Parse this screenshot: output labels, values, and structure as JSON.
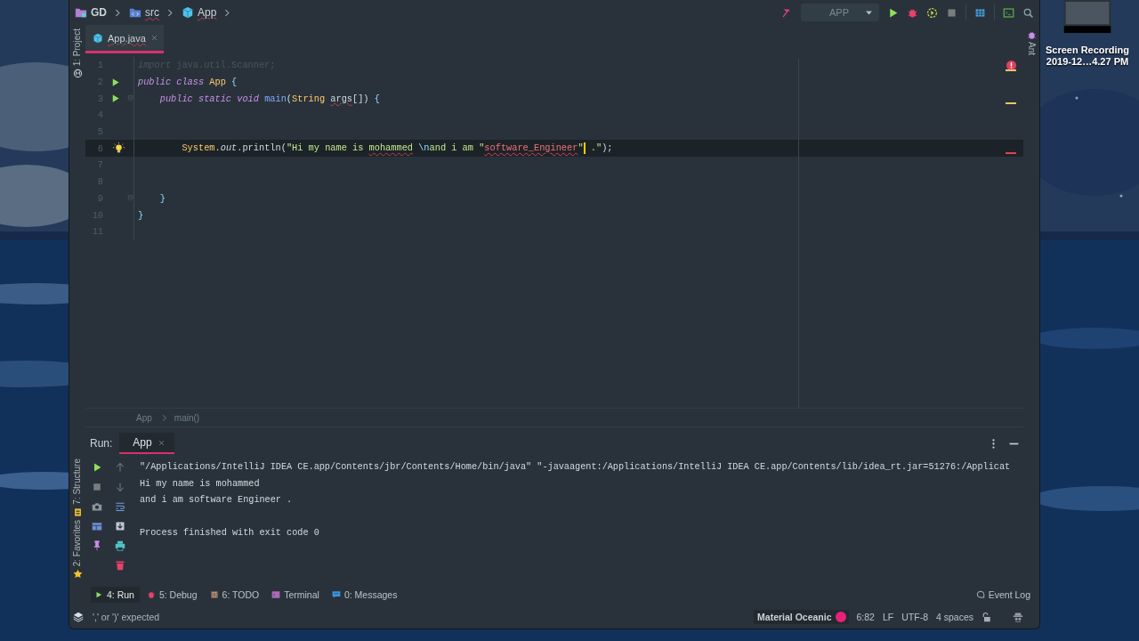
{
  "desktop_icon": {
    "label_lines": [
      "Screen Recording",
      "2019-12…4.27 PM"
    ]
  },
  "breadcrumbs": [
    {
      "label": "GD",
      "kind": "project"
    },
    {
      "label": "src",
      "kind": "source"
    },
    {
      "label": "App",
      "kind": "class"
    }
  ],
  "toolbar": {
    "run_configuration": "APP"
  },
  "left_tool_windows": {
    "top": [
      {
        "label": "1: Project",
        "kind": "project"
      }
    ],
    "bottom": [
      {
        "label": "7: Structure",
        "kind": "structure"
      },
      {
        "label": "2: Favorites",
        "kind": "favorites"
      }
    ]
  },
  "right_tool_windows": [
    {
      "label": "Ant"
    }
  ],
  "editor_tabs": [
    {
      "label": "App.java",
      "selected": true
    }
  ],
  "editor": {
    "lines": [
      {
        "number": "1",
        "current": false,
        "runnable": false,
        "foldable": false,
        "intention": false,
        "tokens": [
          {
            "kind": "comment-kw",
            "text": "import"
          },
          {
            "kind": "comment",
            "text": " java.util.Scanner;"
          }
        ]
      },
      {
        "number": "2",
        "current": false,
        "runnable": true,
        "foldable": false,
        "intention": false,
        "tokens": [
          {
            "kind": "keyword",
            "text": "public class "
          },
          {
            "kind": "type",
            "text": "App "
          },
          {
            "kind": "brace",
            "text": "{"
          }
        ]
      },
      {
        "number": "3",
        "current": false,
        "runnable": true,
        "foldable": true,
        "intention": false,
        "tokens": [
          {
            "kind": "keyword",
            "text": "    public static void "
          },
          {
            "kind": "method",
            "text": "main"
          },
          {
            "kind": "plain",
            "text": "("
          },
          {
            "kind": "type",
            "text": "String "
          },
          {
            "kind": "warn",
            "text": "args"
          },
          {
            "kind": "plain",
            "text": "[]) "
          },
          {
            "kind": "brace",
            "text": "{"
          }
        ]
      },
      {
        "number": "4",
        "current": false,
        "runnable": false,
        "foldable": false,
        "intention": false
      },
      {
        "number": "5",
        "current": false,
        "runnable": false,
        "foldable": false,
        "intention": false
      },
      {
        "number": "6",
        "current": true,
        "runnable": false,
        "foldable": false,
        "intention": true,
        "tokens": [
          {
            "kind": "type",
            "text": "        System"
          },
          {
            "kind": "plain",
            "text": "."
          },
          {
            "kind": "field",
            "text": "out"
          },
          {
            "kind": "plain",
            "text": ".println("
          },
          {
            "kind": "string",
            "text": "\"Hi my name is "
          },
          {
            "kind": "string-warn",
            "text": "mohammed"
          },
          {
            "kind": "escape",
            "text": " \\n"
          },
          {
            "kind": "string",
            "text": "and i am \""
          },
          {
            "kind": "error",
            "text": "software_Engineer"
          },
          {
            "kind": "string",
            "text": "\""
          },
          {
            "kind": "caret"
          },
          {
            "kind": "string",
            "text": " .\""
          },
          {
            "kind": "plain",
            "text": ");"
          }
        ]
      },
      {
        "number": "7",
        "current": false,
        "runnable": false,
        "foldable": false,
        "intention": false
      },
      {
        "number": "8",
        "current": false,
        "runnable": false,
        "foldable": false,
        "intention": false
      },
      {
        "number": "9",
        "current": false,
        "runnable": false,
        "foldable": true,
        "intention": false,
        "tokens": [
          {
            "kind": "brace",
            "text": "    }"
          }
        ]
      },
      {
        "number": "10",
        "current": false,
        "runnable": false,
        "foldable": false,
        "intention": false,
        "tokens": [
          {
            "kind": "brace",
            "text": "}"
          }
        ]
      },
      {
        "number": "11",
        "current": false,
        "runnable": false,
        "foldable": false,
        "intention": false
      }
    ]
  },
  "editor_breadcrumbs": [
    "App",
    "main()"
  ],
  "run_panel": {
    "label": "Run:",
    "tabs": [
      {
        "label": "App",
        "selected": true
      }
    ],
    "output": [
      {
        "kind": "command",
        "text": "\"/Applications/IntelliJ IDEA CE.app/Contents/jbr/Contents/Home/bin/java\" \"-javaagent:/Applications/IntelliJ IDEA CE.app/Contents/lib/idea_rt.jar=51276:/Applicat"
      },
      {
        "kind": "stdout",
        "text": "Hi my name is mohammed"
      },
      {
        "kind": "stdout",
        "text": "and i am software Engineer ."
      },
      {
        "kind": "system",
        "text": "Process finished with exit code 0"
      }
    ]
  },
  "tool_tabs": [
    {
      "label": "4: Run",
      "kind": "run",
      "selected": true
    },
    {
      "label": "5: Debug",
      "kind": "debug",
      "selected": false
    },
    {
      "label": "6: TODO",
      "kind": "todo",
      "selected": false
    },
    {
      "label": "Terminal",
      "kind": "terminal",
      "selected": false
    },
    {
      "label": "0: Messages",
      "kind": "messages",
      "selected": false
    }
  ],
  "event_log": "Event Log",
  "status_bar": {
    "message": "',' or ')' expected",
    "theme": "Material Oceanic",
    "position": "6:82",
    "line_separator": "LF",
    "encoding": "UTF-8",
    "indent": "4 spaces"
  }
}
